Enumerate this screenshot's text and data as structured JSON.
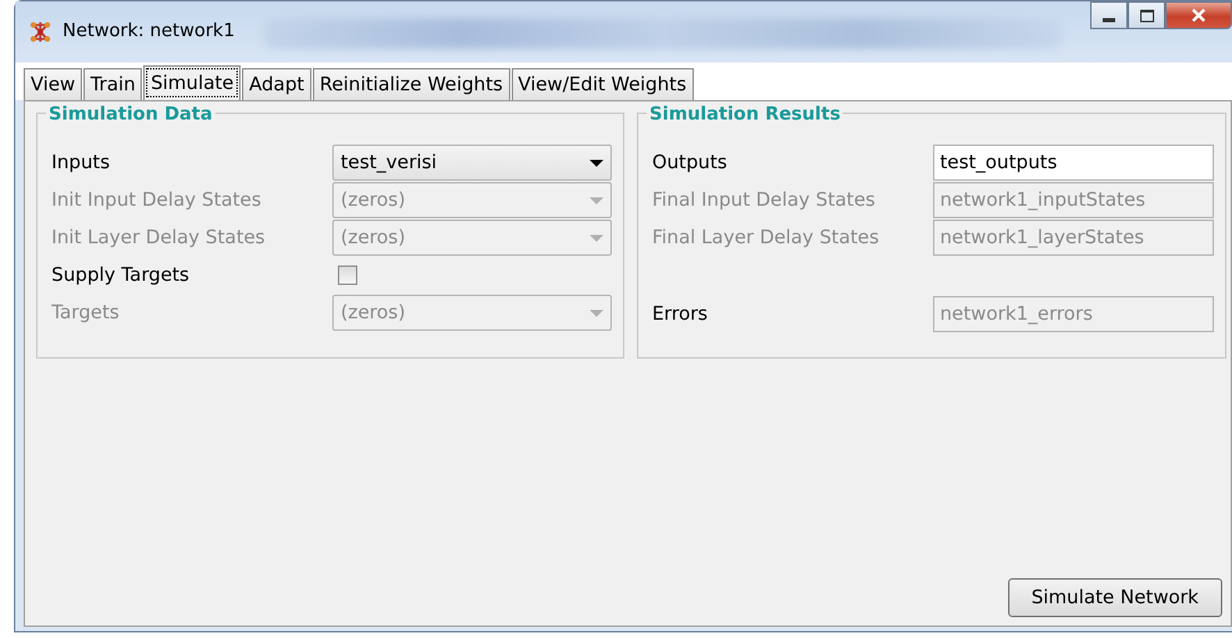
{
  "window": {
    "title": "Network: network1"
  },
  "tabs": [
    {
      "label": "View",
      "selected": false
    },
    {
      "label": "Train",
      "selected": false
    },
    {
      "label": "Simulate",
      "selected": true
    },
    {
      "label": "Adapt",
      "selected": false
    },
    {
      "label": "Reinitialize Weights",
      "selected": false
    },
    {
      "label": "View/Edit Weights",
      "selected": false
    }
  ],
  "simulation_data": {
    "title": "Simulation Data",
    "rows": [
      {
        "kind": "combo",
        "label": "Inputs",
        "value": "test_verisi",
        "disabled": false
      },
      {
        "kind": "combo",
        "label": "Init Input Delay States",
        "value": "(zeros)",
        "disabled": true
      },
      {
        "kind": "combo",
        "label": "Init Layer Delay States",
        "value": "(zeros)",
        "disabled": true
      },
      {
        "kind": "checkbox",
        "label": "Supply Targets",
        "checked": false
      },
      {
        "kind": "combo",
        "label": "Targets",
        "value": "(zeros)",
        "disabled": true
      }
    ]
  },
  "simulation_results": {
    "title": "Simulation Results",
    "rows": [
      {
        "kind": "field",
        "label": "Outputs",
        "label_disabled": false,
        "value": "test_outputs",
        "disabled": false
      },
      {
        "kind": "field",
        "label": "Final Input Delay States",
        "label_disabled": true,
        "value": "network1_inputStates",
        "disabled": true
      },
      {
        "kind": "field",
        "label": "Final Layer Delay States",
        "label_disabled": true,
        "value": "network1_layerStates",
        "disabled": true
      },
      {
        "kind": "gap"
      },
      {
        "kind": "field",
        "label": "Errors",
        "label_disabled": false,
        "value": "network1_errors",
        "disabled": true
      }
    ]
  },
  "buttons": [
    "Simulate Network"
  ]
}
